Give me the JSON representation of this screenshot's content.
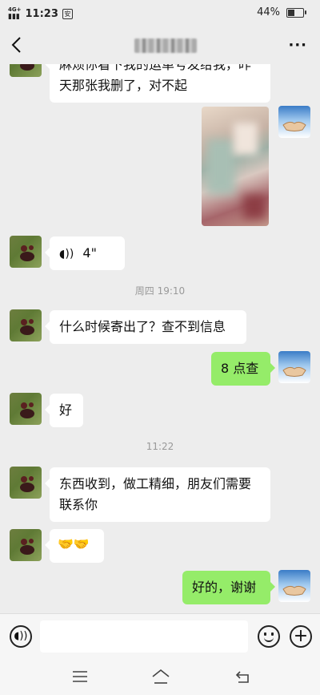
{
  "status_bar": {
    "network": "4G+",
    "time": "11:23",
    "badge": "安",
    "battery_percent": "44%",
    "battery_level": 0.44
  },
  "header": {
    "back_icon": "chevron-left-icon",
    "more_label": "···"
  },
  "messages": [
    {
      "side": "left",
      "type": "text",
      "text": "麻烦你看下我的运单号发给我，昨天那张我删了，对不起"
    },
    {
      "side": "right",
      "type": "image"
    },
    {
      "side": "left",
      "type": "voice",
      "duration": "4\""
    },
    {
      "type": "timestamp",
      "text": "周四 19:10"
    },
    {
      "side": "left",
      "type": "text",
      "text": "什么时候寄出了？查不到信息"
    },
    {
      "side": "right",
      "type": "text",
      "text": "8 点查"
    },
    {
      "side": "left",
      "type": "text",
      "text": "好"
    },
    {
      "type": "timestamp",
      "text": "11:22"
    },
    {
      "side": "left",
      "type": "text",
      "line1": "东西收到，做工精细，朋友们需要",
      "line2": "联系你"
    },
    {
      "side": "left",
      "type": "emoji",
      "text": "🤝🤝"
    },
    {
      "side": "right",
      "type": "text",
      "text": "好的，谢谢"
    }
  ],
  "input_bar": {
    "voice_icon": "voice-icon",
    "emoji_icon": "emoji-icon",
    "plus_icon": "plus-icon",
    "voice_glyph": "◖))",
    "plus_glyph": "+"
  },
  "nav_bar": {
    "menu_icon": "menu-icon",
    "home_icon": "home-icon",
    "back_icon": "back-icon"
  }
}
